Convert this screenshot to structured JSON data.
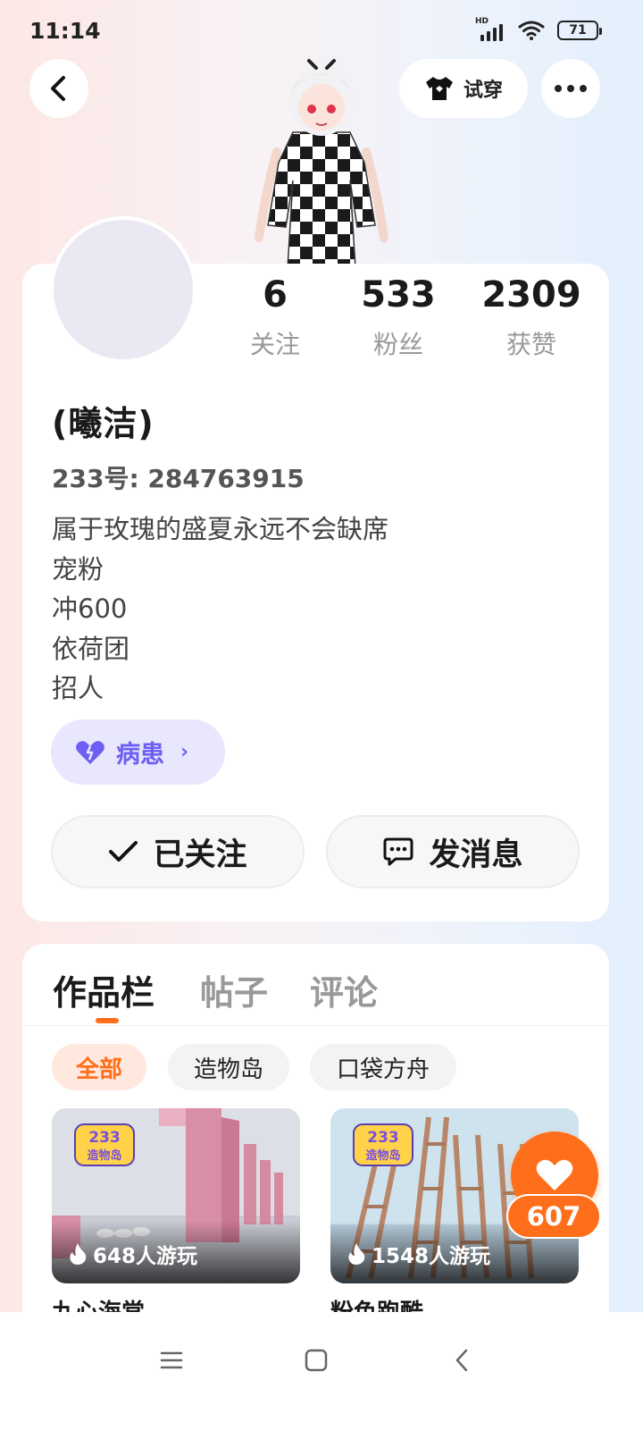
{
  "status_bar": {
    "time": "11:14",
    "network_badge": "HD",
    "battery": "71"
  },
  "header": {
    "back_icon": "chevron-left-icon",
    "try_on_label": "试穿",
    "try_on_icon": "shirt-icon",
    "more_icon": "more-dots-icon"
  },
  "profile": {
    "nickname": "(曦洁)",
    "uid": "233号: 284763915",
    "bio_lines": [
      "属于玫瑰的盛夏永远不会缺席",
      "宠粉",
      "冲600",
      "依荷团",
      "招人"
    ],
    "stats": [
      {
        "value": "6",
        "label": "关注"
      },
      {
        "value": "533",
        "label": "粉丝"
      },
      {
        "value": "2309",
        "label": "获赞"
      }
    ],
    "tag": {
      "label": "病患",
      "icon": "heart-icon",
      "color": "#6d5ff4"
    }
  },
  "actions": {
    "follow_label": "已关注",
    "message_label": "发消息"
  },
  "works": {
    "tabs": [
      "作品栏",
      "帖子",
      "评论"
    ],
    "active_tab": 0,
    "filters": [
      "全部",
      "造物岛",
      "口袋方舟"
    ],
    "active_filter": 0,
    "badge_text": "233 造物岛",
    "items": [
      {
        "plays": "648人游玩",
        "title": "九心海棠"
      },
      {
        "plays": "1548人游玩",
        "title": "粉色跑酷"
      }
    ]
  },
  "like": {
    "count": "607"
  },
  "colors": {
    "accent": "#ff6f1b",
    "tag_purple": "#6d5ff4"
  }
}
